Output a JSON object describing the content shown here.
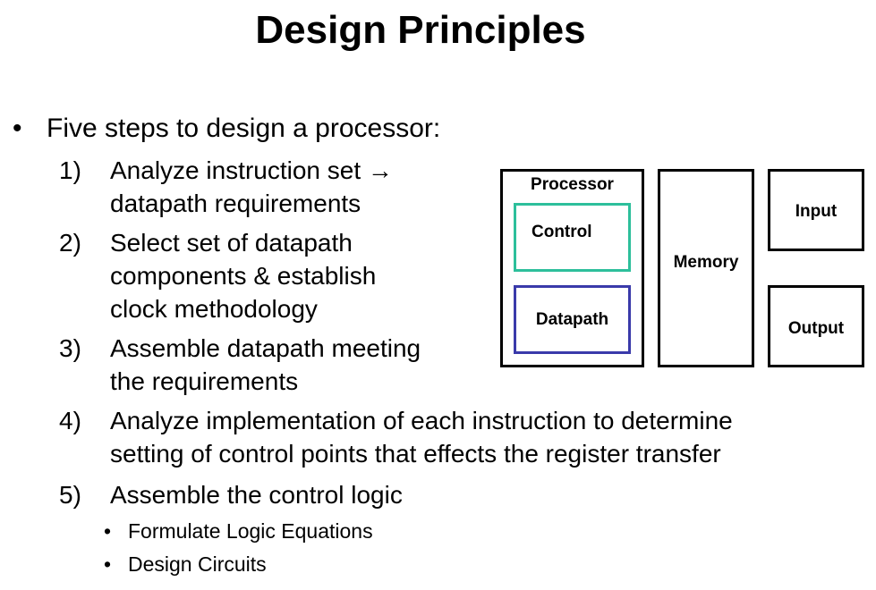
{
  "slide": {
    "title": "Design Principles",
    "bullet_symbol": "•",
    "main_bullet": "Five steps to design a processor:",
    "steps": [
      {
        "number": "1)",
        "lines": [
          "Analyze instruction set →",
          "datapath requirements"
        ]
      },
      {
        "number": "2)",
        "lines": [
          "Select set of datapath",
          "components & establish",
          "clock methodology"
        ]
      },
      {
        "number": "3)",
        "lines": [
          "Assemble datapath meeting",
          "the requirements"
        ]
      },
      {
        "number": "4)",
        "lines": [
          "Analyze implementation of each instruction to determine",
          "setting of control points that effects the register transfer"
        ]
      },
      {
        "number": "5)",
        "lines": [
          "Assemble the control logic"
        ]
      }
    ],
    "sub_bullets": [
      "Formulate Logic Equations",
      "Design Circuits"
    ]
  },
  "diagram": {
    "processor_label": "Processor",
    "control_label": "Control",
    "datapath_label": "Datapath",
    "memory_label": "Memory",
    "input_label": "Input",
    "output_label": "Output",
    "control_border_color": "#2dbf9b",
    "datapath_border_color": "#3a3aaa"
  }
}
